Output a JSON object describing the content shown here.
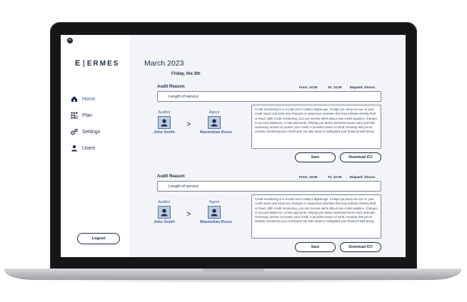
{
  "sidebar": {
    "brand_mark": "E",
    "brand_text": "ERMES",
    "items": [
      {
        "label": "Home",
        "icon": "home-icon"
      },
      {
        "label": "Plan",
        "icon": "plan-icon"
      },
      {
        "label": "Settings",
        "icon": "settings-icon"
      },
      {
        "label": "Users",
        "icon": "users-icon"
      }
    ],
    "logout_label": "Logout"
  },
  "main": {
    "month_title": "March 2023",
    "day_title": "Friday, the 3th",
    "cards": [
      {
        "title": "Audit Reason",
        "from": "From: 10:00",
        "to": "To: 12:00",
        "elapsed": "Elapsed: 2hours",
        "reason": "Length of service",
        "auditor_role": "Auditor",
        "auditor_name": "John Smith",
        "arrow": ">",
        "agent_role": "Agent",
        "agent_name": "Maximilian Rossi",
        "description": "Credit monitoring is a crucial tool in today's digital age. It helps you keep an eye on your credit report and track any changes or suspicious activities that may indicate identity theft or fraud. With credit monitoring, you can receive alerts about new credit inquiries, changes in account balances, or late payments, helping you detect potential issues early and take necessary actions to protect your credit. It provides peace of mind, knowing that you're actively monitoring your credit and can take steps to safeguard your financial well-being.",
        "save_label": "Save",
        "download_label": "Download ICV"
      },
      {
        "title": "Audit Reason",
        "from": "From: 10:00",
        "to": "To: 12:00",
        "elapsed": "Elapsed: 2hours",
        "reason": "Length of service",
        "auditor_role": "Auditor",
        "auditor_name": "John Smith",
        "arrow": ">",
        "agent_role": "Agent",
        "agent_name": "Maximilian Rossi",
        "description": "Credit monitoring is a crucial tool in today's digital age. It helps you keep an eye on your credit report and track any changes or suspicious activities that may indicate identity theft or fraud. With credit monitoring, you can receive alerts about new credit inquiries, changes in account balances, or late payments, helping you detect potential issues early and take necessary actions to protect your credit. It provides peace of mind, knowing that you're actively monitoring your credit and can take steps to safeguard your financial well-being.",
        "save_label": "Save",
        "download_label": "Download ICV"
      }
    ]
  },
  "colors": {
    "navy": "#1f2a44",
    "accent_blue": "#3f5fa8",
    "avatar_fill": "#b9cbe6",
    "main_bg": "#f3f4f7"
  }
}
